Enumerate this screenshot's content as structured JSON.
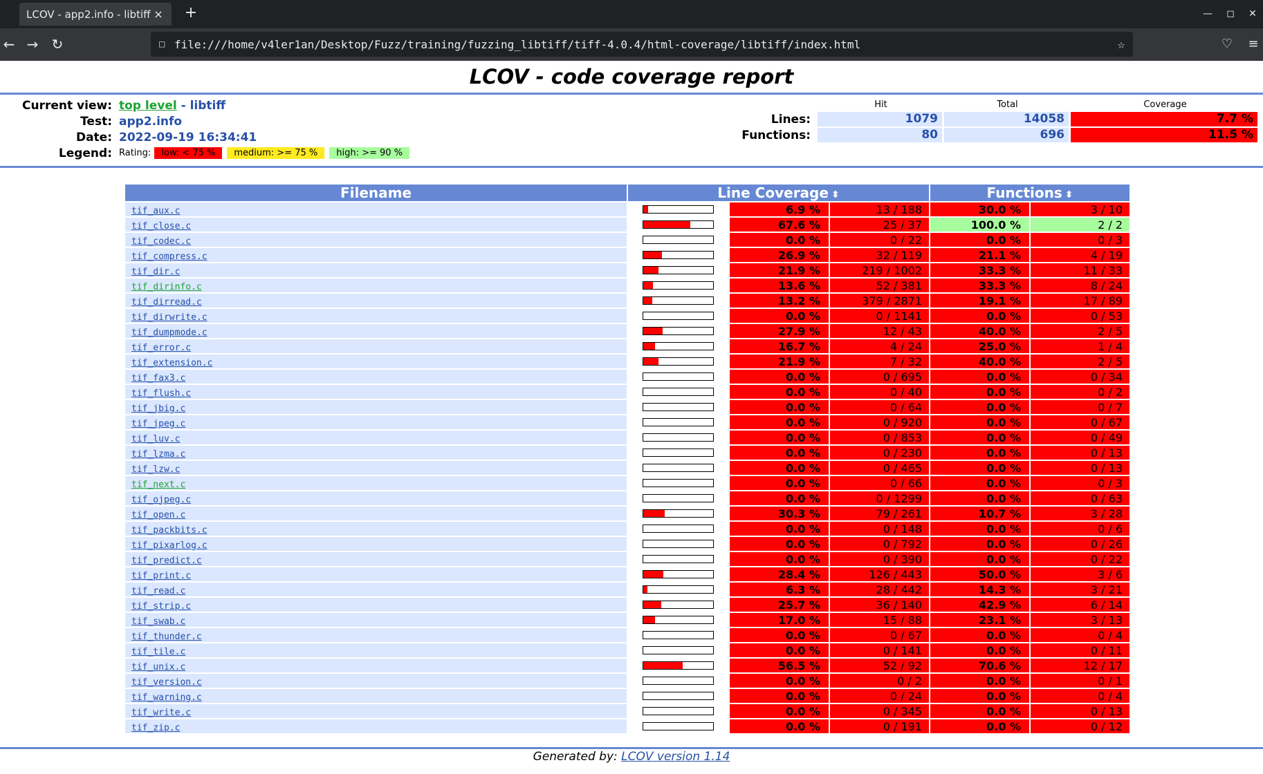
{
  "browser": {
    "tab_title": "LCOV - app2.info - libtiff",
    "tab_close": "×",
    "new_tab": "+",
    "url": "file:///home/v4ler1an/Desktop/Fuzz/training/fuzzing_libtiff/tiff-4.0.4/html-coverage/libtiff/index.html"
  },
  "report": {
    "title": "LCOV - code coverage report",
    "current_view_label": "Current view:",
    "current_view_link": "top level",
    "current_view_sep": " - libtiff",
    "test_label": "Test:",
    "test_value": "app2.info",
    "date_label": "Date:",
    "date_value": "2022-09-19 16:34:41",
    "legend_label": "Legend:",
    "legend_rating": "Rating:",
    "legend_low": "low: < 75 %",
    "legend_medium": "medium: >= 75 %",
    "legend_high": "high: >= 90 %",
    "stats_head_hit": "Hit",
    "stats_head_total": "Total",
    "stats_head_coverage": "Coverage",
    "lines_label": "Lines:",
    "lines_hit": "1079",
    "lines_total": "14058",
    "lines_cov": "7.7 %",
    "functions_label": "Functions:",
    "functions_hit": "80",
    "functions_total": "696",
    "functions_cov": "11.5 %"
  },
  "table": {
    "col_filename": "Filename",
    "col_line_coverage": "Line Coverage",
    "col_functions": "Functions",
    "rows": [
      {
        "file": "tif_aux.c",
        "line_frac": 0.069,
        "line_pct": "6.9 %",
        "line_cnt": "13 / 188",
        "fn_pct": "30.0 %",
        "fn_cnt": "3 / 10",
        "fn_high": false,
        "visited": false
      },
      {
        "file": "tif_close.c",
        "line_frac": 0.676,
        "line_pct": "67.6 %",
        "line_cnt": "25 / 37",
        "fn_pct": "100.0 %",
        "fn_cnt": "2 / 2",
        "fn_high": true,
        "visited": false
      },
      {
        "file": "tif_codec.c",
        "line_frac": 0.0,
        "line_pct": "0.0 %",
        "line_cnt": "0 / 22",
        "fn_pct": "0.0 %",
        "fn_cnt": "0 / 3",
        "fn_high": false,
        "visited": false
      },
      {
        "file": "tif_compress.c",
        "line_frac": 0.269,
        "line_pct": "26.9 %",
        "line_cnt": "32 / 119",
        "fn_pct": "21.1 %",
        "fn_cnt": "4 / 19",
        "fn_high": false,
        "visited": false
      },
      {
        "file": "tif_dir.c",
        "line_frac": 0.219,
        "line_pct": "21.9 %",
        "line_cnt": "219 / 1002",
        "fn_pct": "33.3 %",
        "fn_cnt": "11 / 33",
        "fn_high": false,
        "visited": false
      },
      {
        "file": "tif_dirinfo.c",
        "line_frac": 0.136,
        "line_pct": "13.6 %",
        "line_cnt": "52 / 381",
        "fn_pct": "33.3 %",
        "fn_cnt": "8 / 24",
        "fn_high": false,
        "visited": true
      },
      {
        "file": "tif_dirread.c",
        "line_frac": 0.132,
        "line_pct": "13.2 %",
        "line_cnt": "379 / 2871",
        "fn_pct": "19.1 %",
        "fn_cnt": "17 / 89",
        "fn_high": false,
        "visited": false
      },
      {
        "file": "tif_dirwrite.c",
        "line_frac": 0.0,
        "line_pct": "0.0 %",
        "line_cnt": "0 / 1141",
        "fn_pct": "0.0 %",
        "fn_cnt": "0 / 53",
        "fn_high": false,
        "visited": false
      },
      {
        "file": "tif_dumpmode.c",
        "line_frac": 0.279,
        "line_pct": "27.9 %",
        "line_cnt": "12 / 43",
        "fn_pct": "40.0 %",
        "fn_cnt": "2 / 5",
        "fn_high": false,
        "visited": false
      },
      {
        "file": "tif_error.c",
        "line_frac": 0.167,
        "line_pct": "16.7 %",
        "line_cnt": "4 / 24",
        "fn_pct": "25.0 %",
        "fn_cnt": "1 / 4",
        "fn_high": false,
        "visited": false
      },
      {
        "file": "tif_extension.c",
        "line_frac": 0.219,
        "line_pct": "21.9 %",
        "line_cnt": "7 / 32",
        "fn_pct": "40.0 %",
        "fn_cnt": "2 / 5",
        "fn_high": false,
        "visited": false
      },
      {
        "file": "tif_fax3.c",
        "line_frac": 0.0,
        "line_pct": "0.0 %",
        "line_cnt": "0 / 695",
        "fn_pct": "0.0 %",
        "fn_cnt": "0 / 34",
        "fn_high": false,
        "visited": false
      },
      {
        "file": "tif_flush.c",
        "line_frac": 0.0,
        "line_pct": "0.0 %",
        "line_cnt": "0 / 40",
        "fn_pct": "0.0 %",
        "fn_cnt": "0 / 2",
        "fn_high": false,
        "visited": false
      },
      {
        "file": "tif_jbig.c",
        "line_frac": 0.0,
        "line_pct": "0.0 %",
        "line_cnt": "0 / 64",
        "fn_pct": "0.0 %",
        "fn_cnt": "0 / 7",
        "fn_high": false,
        "visited": false
      },
      {
        "file": "tif_jpeg.c",
        "line_frac": 0.0,
        "line_pct": "0.0 %",
        "line_cnt": "0 / 920",
        "fn_pct": "0.0 %",
        "fn_cnt": "0 / 67",
        "fn_high": false,
        "visited": false
      },
      {
        "file": "tif_luv.c",
        "line_frac": 0.0,
        "line_pct": "0.0 %",
        "line_cnt": "0 / 853",
        "fn_pct": "0.0 %",
        "fn_cnt": "0 / 49",
        "fn_high": false,
        "visited": false
      },
      {
        "file": "tif_lzma.c",
        "line_frac": 0.0,
        "line_pct": "0.0 %",
        "line_cnt": "0 / 230",
        "fn_pct": "0.0 %",
        "fn_cnt": "0 / 13",
        "fn_high": false,
        "visited": false
      },
      {
        "file": "tif_lzw.c",
        "line_frac": 0.0,
        "line_pct": "0.0 %",
        "line_cnt": "0 / 465",
        "fn_pct": "0.0 %",
        "fn_cnt": "0 / 13",
        "fn_high": false,
        "visited": false
      },
      {
        "file": "tif_next.c",
        "line_frac": 0.0,
        "line_pct": "0.0 %",
        "line_cnt": "0 / 66",
        "fn_pct": "0.0 %",
        "fn_cnt": "0 / 3",
        "fn_high": false,
        "visited": true
      },
      {
        "file": "tif_ojpeg.c",
        "line_frac": 0.0,
        "line_pct": "0.0 %",
        "line_cnt": "0 / 1299",
        "fn_pct": "0.0 %",
        "fn_cnt": "0 / 63",
        "fn_high": false,
        "visited": false
      },
      {
        "file": "tif_open.c",
        "line_frac": 0.303,
        "line_pct": "30.3 %",
        "line_cnt": "79 / 261",
        "fn_pct": "10.7 %",
        "fn_cnt": "3 / 28",
        "fn_high": false,
        "visited": false
      },
      {
        "file": "tif_packbits.c",
        "line_frac": 0.0,
        "line_pct": "0.0 %",
        "line_cnt": "0 / 148",
        "fn_pct": "0.0 %",
        "fn_cnt": "0 / 6",
        "fn_high": false,
        "visited": false
      },
      {
        "file": "tif_pixarlog.c",
        "line_frac": 0.0,
        "line_pct": "0.0 %",
        "line_cnt": "0 / 792",
        "fn_pct": "0.0 %",
        "fn_cnt": "0 / 26",
        "fn_high": false,
        "visited": false
      },
      {
        "file": "tif_predict.c",
        "line_frac": 0.0,
        "line_pct": "0.0 %",
        "line_cnt": "0 / 390",
        "fn_pct": "0.0 %",
        "fn_cnt": "0 / 22",
        "fn_high": false,
        "visited": false
      },
      {
        "file": "tif_print.c",
        "line_frac": 0.284,
        "line_pct": "28.4 %",
        "line_cnt": "126 / 443",
        "fn_pct": "50.0 %",
        "fn_cnt": "3 / 6",
        "fn_high": false,
        "visited": false
      },
      {
        "file": "tif_read.c",
        "line_frac": 0.063,
        "line_pct": "6.3 %",
        "line_cnt": "28 / 442",
        "fn_pct": "14.3 %",
        "fn_cnt": "3 / 21",
        "fn_high": false,
        "visited": false
      },
      {
        "file": "tif_strip.c",
        "line_frac": 0.257,
        "line_pct": "25.7 %",
        "line_cnt": "36 / 140",
        "fn_pct": "42.9 %",
        "fn_cnt": "6 / 14",
        "fn_high": false,
        "visited": false
      },
      {
        "file": "tif_swab.c",
        "line_frac": 0.17,
        "line_pct": "17.0 %",
        "line_cnt": "15 / 88",
        "fn_pct": "23.1 %",
        "fn_cnt": "3 / 13",
        "fn_high": false,
        "visited": false
      },
      {
        "file": "tif_thunder.c",
        "line_frac": 0.0,
        "line_pct": "0.0 %",
        "line_cnt": "0 / 67",
        "fn_pct": "0.0 %",
        "fn_cnt": "0 / 4",
        "fn_high": false,
        "visited": false
      },
      {
        "file": "tif_tile.c",
        "line_frac": 0.0,
        "line_pct": "0.0 %",
        "line_cnt": "0 / 141",
        "fn_pct": "0.0 %",
        "fn_cnt": "0 / 11",
        "fn_high": false,
        "visited": false
      },
      {
        "file": "tif_unix.c",
        "line_frac": 0.565,
        "line_pct": "56.5 %",
        "line_cnt": "52 / 92",
        "fn_pct": "70.6 %",
        "fn_cnt": "12 / 17",
        "fn_high": false,
        "visited": false
      },
      {
        "file": "tif_version.c",
        "line_frac": 0.0,
        "line_pct": "0.0 %",
        "line_cnt": "0 / 2",
        "fn_pct": "0.0 %",
        "fn_cnt": "0 / 1",
        "fn_high": false,
        "visited": false
      },
      {
        "file": "tif_warning.c",
        "line_frac": 0.0,
        "line_pct": "0.0 %",
        "line_cnt": "0 / 24",
        "fn_pct": "0.0 %",
        "fn_cnt": "0 / 4",
        "fn_high": false,
        "visited": false
      },
      {
        "file": "tif_write.c",
        "line_frac": 0.0,
        "line_pct": "0.0 %",
        "line_cnt": "0 / 345",
        "fn_pct": "0.0 %",
        "fn_cnt": "0 / 13",
        "fn_high": false,
        "visited": false
      },
      {
        "file": "tif_zip.c",
        "line_frac": 0.0,
        "line_pct": "0.0 %",
        "line_cnt": "0 / 191",
        "fn_pct": "0.0 %",
        "fn_cnt": "0 / 12",
        "fn_high": false,
        "visited": false
      }
    ]
  },
  "footer": {
    "generated_by": "Generated by: ",
    "link_text": "LCOV version 1.14"
  },
  "colors": {
    "low": "#ff0000",
    "high": "#a7fc9d",
    "header": "#6688d4",
    "link": "#284fa8",
    "visited": "#1ea233"
  }
}
